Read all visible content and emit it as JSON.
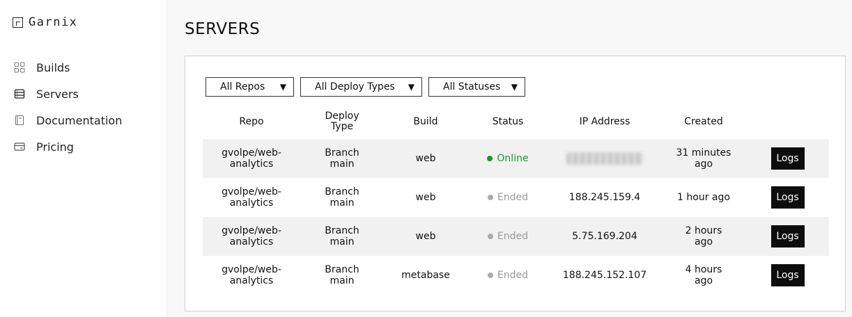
{
  "brand": {
    "name": "Garnix"
  },
  "sidebar": {
    "items": [
      {
        "label": "Builds",
        "icon": "grid-icon"
      },
      {
        "label": "Servers",
        "icon": "server-icon"
      },
      {
        "label": "Documentation",
        "icon": "book-icon"
      },
      {
        "label": "Pricing",
        "icon": "credit-card-icon"
      }
    ]
  },
  "page": {
    "title": "SERVERS"
  },
  "filters": [
    {
      "label": "All Repos"
    },
    {
      "label": "All Deploy Types"
    },
    {
      "label": "All Statuses"
    }
  ],
  "table": {
    "headers": {
      "repo": "Repo",
      "deploy_type": "Deploy Type",
      "build": "Build",
      "status": "Status",
      "ip": "IP Address",
      "created": "Created"
    },
    "rows": [
      {
        "repo": "gvolpe/web-analytics",
        "deploy_type": "Branch main",
        "build": "web",
        "status": "Online",
        "ip": "",
        "created": "31 minutes ago",
        "action": "Logs"
      },
      {
        "repo": "gvolpe/web-analytics",
        "deploy_type": "Branch main",
        "build": "web",
        "status": "Ended",
        "ip": "188.245.159.4",
        "created": "1 hour ago",
        "action": "Logs"
      },
      {
        "repo": "gvolpe/web-analytics",
        "deploy_type": "Branch main",
        "build": "web",
        "status": "Ended",
        "ip": "5.75.169.204",
        "created": "2 hours ago",
        "action": "Logs"
      },
      {
        "repo": "gvolpe/web-analytics",
        "deploy_type": "Branch main",
        "build": "metabase",
        "status": "Ended",
        "ip": "188.245.152.107",
        "created": "4 hours ago",
        "action": "Logs"
      }
    ]
  },
  "colors": {
    "online": "#1a9a2e",
    "ended": "#999999",
    "button_bg": "#0d0d0d"
  }
}
